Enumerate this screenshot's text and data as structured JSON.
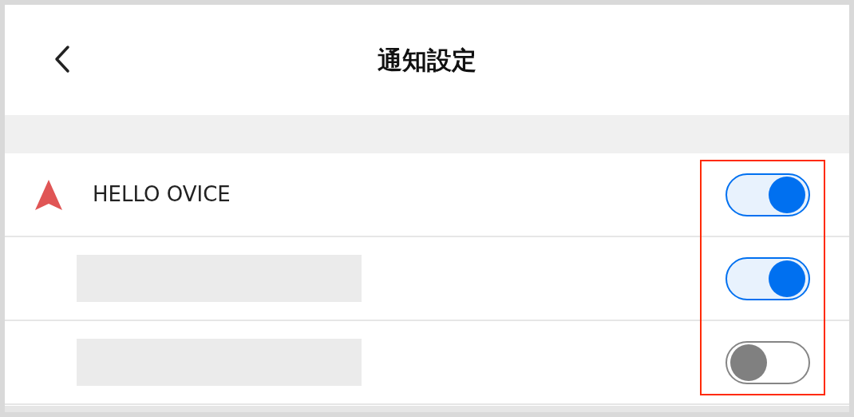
{
  "header": {
    "title": "通知設定"
  },
  "toggles_highlighted": true,
  "rows": [
    {
      "kind": "app",
      "label": "HELLO OVICE",
      "on": true
    },
    {
      "kind": "redacted",
      "on": true
    },
    {
      "kind": "redacted",
      "on": false
    }
  ]
}
